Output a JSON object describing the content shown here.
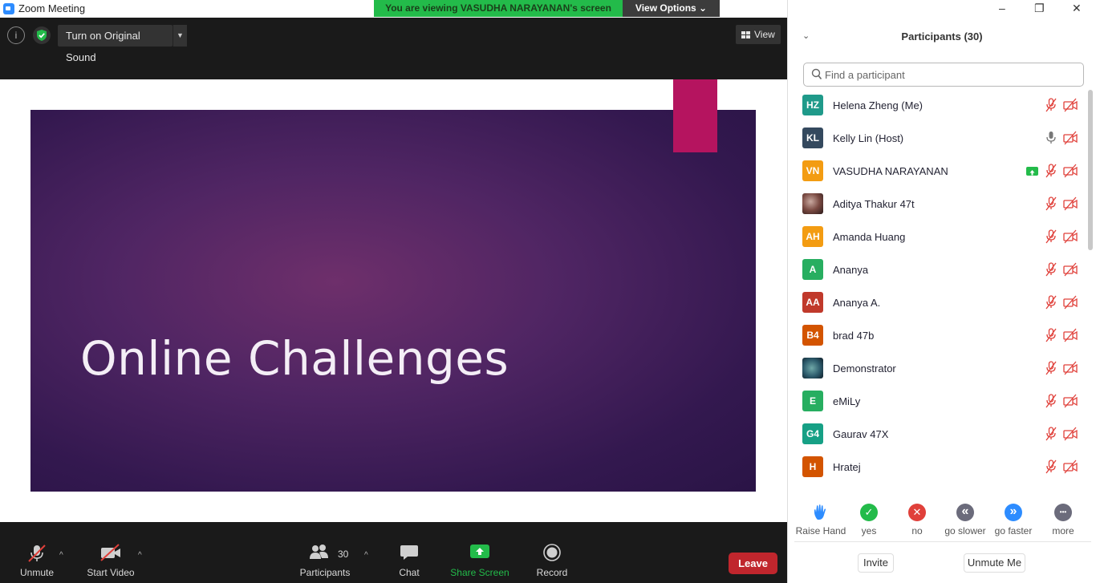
{
  "window": {
    "title": "Zoom Meeting",
    "minimize": "–",
    "restore": "❐",
    "close": "✕"
  },
  "banner": {
    "viewing_text": "You are viewing VASUDHA NARAYANAN's screen",
    "view_options": "View Options ⌄"
  },
  "topbar": {
    "info_glyph": "i",
    "original_sound": "Turn on Original Sound",
    "caret": "▼",
    "view": "View"
  },
  "slide": {
    "title": "Online Challenges"
  },
  "toolbar": {
    "unmute": "Unmute",
    "start_video": "Start Video",
    "participants": "Participants",
    "participants_count": "30",
    "chat": "Chat",
    "share_screen": "Share Screen",
    "record": "Record",
    "leave": "Leave",
    "caret": "^"
  },
  "panel": {
    "title": "Participants (30)",
    "chevron": "⌄",
    "search_placeholder": "Find a participant",
    "participants": [
      {
        "initials": "HZ",
        "name": "Helena Zheng (Me)",
        "color": "#1f9a8a",
        "mic": "muted",
        "video": "off"
      },
      {
        "initials": "KL",
        "name": "Kelly Lin (Host)",
        "color": "#34495e",
        "mic": "on",
        "video": "off"
      },
      {
        "initials": "VN",
        "name": "VASUDHA NARAYANAN",
        "color": "#f39c12",
        "mic": "muted",
        "video": "off",
        "sharing": true
      },
      {
        "initials": "",
        "name": "Aditya Thakur 47t",
        "color": "#5a3a3a",
        "mic": "muted",
        "video": "off",
        "photo": true
      },
      {
        "initials": "AH",
        "name": "Amanda Huang",
        "color": "#f39c12",
        "mic": "muted",
        "video": "off"
      },
      {
        "initials": "A",
        "name": "Ananya",
        "color": "#27ae60",
        "mic": "muted",
        "video": "off"
      },
      {
        "initials": "AA",
        "name": "Ananya A.",
        "color": "#c0392b",
        "mic": "muted",
        "video": "off"
      },
      {
        "initials": "B4",
        "name": "brad 47b",
        "color": "#d35400",
        "mic": "muted",
        "video": "off"
      },
      {
        "initials": "",
        "name": "Demonstrator",
        "color": "#2c5a6b",
        "mic": "muted",
        "video": "off",
        "photo": true
      },
      {
        "initials": "E",
        "name": "eMiLy",
        "color": "#27ae60",
        "mic": "muted",
        "video": "off"
      },
      {
        "initials": "G4",
        "name": "Gaurav 47X",
        "color": "#16a085",
        "mic": "muted",
        "video": "off"
      },
      {
        "initials": "H",
        "name": "Hratej",
        "color": "#d35400",
        "mic": "muted",
        "video": "off"
      }
    ],
    "reactions": [
      {
        "label": "Raise Hand",
        "glyph": "✋",
        "color": "#2d8cff",
        "kind": "hand"
      },
      {
        "label": "yes",
        "glyph": "✓",
        "color": "#23bb4a",
        "kind": "circle"
      },
      {
        "label": "no",
        "glyph": "✕",
        "color": "#e0403a",
        "kind": "circle"
      },
      {
        "label": "go slower",
        "glyph": "«",
        "color": "#6b6b7b",
        "kind": "circle"
      },
      {
        "label": "go faster",
        "glyph": "»",
        "color": "#2d8cff",
        "kind": "circle"
      },
      {
        "label": "more",
        "glyph": "•••",
        "color": "#6b6b7b",
        "kind": "circle"
      }
    ],
    "invite": "Invite",
    "unmute_me": "Unmute Me"
  }
}
